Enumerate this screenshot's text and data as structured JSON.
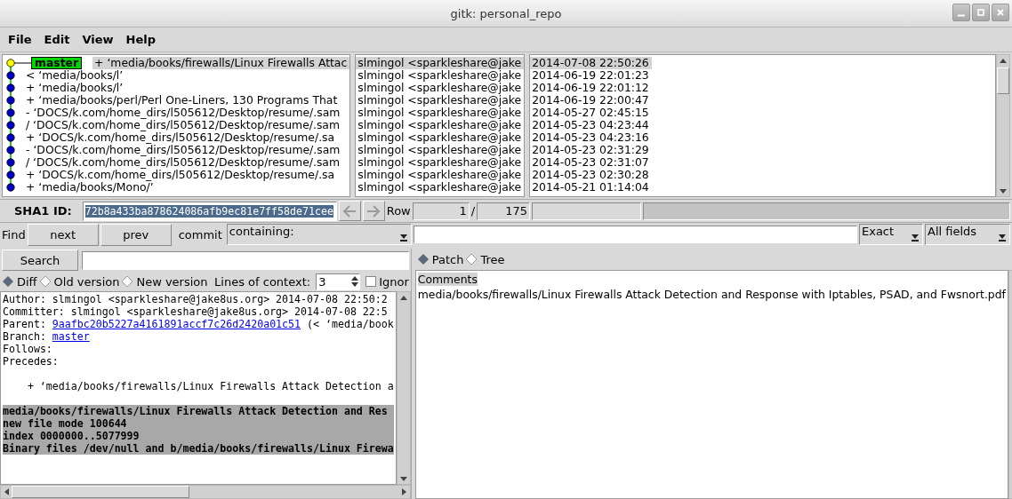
{
  "window": {
    "title": "gitk: personal_repo"
  },
  "menu": [
    "File",
    "Edit",
    "View",
    "Help"
  ],
  "commits": [
    {
      "subject": "+ ‘media/books/firewalls/Linux Firewalls Attac",
      "author": "slmingol <sparkleshare@jake",
      "date": "2014-07-08 22:50:26",
      "selected": true,
      "current": true,
      "branch": "master"
    },
    {
      "subject": "< ‘media/books/l’",
      "author": "slmingol <sparkleshare@jake",
      "date": "2014-06-19 22:01:23",
      "selected": false,
      "current": false
    },
    {
      "subject": "+ ‘media/books/l’",
      "author": "slmingol <sparkleshare@jake",
      "date": "2014-06-19 22:01:12",
      "selected": false,
      "current": false
    },
    {
      "subject": "+ ‘media/books/perl/Perl One-Liners, 130 Programs That",
      "author": "slmingol <sparkleshare@jake",
      "date": "2014-06-19 22:00:47",
      "selected": false,
      "current": false
    },
    {
      "subject": "- ‘DOCS/k.com/home_dirs/l505612/Desktop/resume/.sam",
      "author": "slmingol <sparkleshare@jake",
      "date": "2014-05-27 02:45:15",
      "selected": false,
      "current": false
    },
    {
      "subject": "/ ‘DOCS/k.com/home_dirs/l505612/Desktop/resume/.sam",
      "author": "slmingol <sparkleshare@jake",
      "date": "2014-05-23 04:23:44",
      "selected": false,
      "current": false
    },
    {
      "subject": "+ ‘DOCS/k.com/home_dirs/l505612/Desktop/resume/.sa",
      "author": "slmingol <sparkleshare@jake",
      "date": "2014-05-23 04:23:16",
      "selected": false,
      "current": false
    },
    {
      "subject": "- ‘DOCS/k.com/home_dirs/l505612/Desktop/resume/.sam",
      "author": "slmingol <sparkleshare@jake",
      "date": "2014-05-23 02:31:29",
      "selected": false,
      "current": false
    },
    {
      "subject": "/ ‘DOCS/k.com/home_dirs/l505612/Desktop/resume/.sam",
      "author": "slmingol <sparkleshare@jake",
      "date": "2014-05-23 02:31:07",
      "selected": false,
      "current": false
    },
    {
      "subject": "+ ‘DOCS/k.com/home_dirs/l505612/Desktop/resume/.sa",
      "author": "slmingol <sparkleshare@jake",
      "date": "2014-05-23 02:30:28",
      "selected": false,
      "current": false
    },
    {
      "subject": "+ ‘media/books/Mono/’",
      "author": "slmingol <sparkleshare@jake",
      "date": "2014-05-21 01:14:04",
      "selected": false,
      "current": false
    }
  ],
  "sha1": {
    "label": "SHA1 ID:",
    "value": "72b8a433ba878624086afb9ec81e7ff58de71cee"
  },
  "row": {
    "label": "Row",
    "current": "1",
    "separator": "/",
    "total": "175"
  },
  "find": {
    "label": "Find",
    "next": "next",
    "prev": "prev",
    "type_label": "commit",
    "mode": "containing:",
    "match": "Exact",
    "fields": "All fields"
  },
  "search": {
    "button": "Search"
  },
  "diff_modes": [
    {
      "label": "Diff",
      "selected": true
    },
    {
      "label": "Old version",
      "selected": false
    },
    {
      "label": "New version",
      "selected": false
    }
  ],
  "context": {
    "label": "Lines of context:",
    "value": "3"
  },
  "ignore": {
    "label": "Ignor",
    "checked": false
  },
  "diff_lines": [
    {
      "kind": "text",
      "text": "Author: slmingol <sparkleshare@jake8us.org>  2014-07-08 22:50:2"
    },
    {
      "kind": "text",
      "text": "Committer: slmingol <sparkleshare@jake8us.org>  2014-07-08 22:5"
    },
    {
      "kind": "link",
      "label": "Parent: ",
      "link": "9aafbc20b5227a4161891accf7c26d2420a01c51",
      "suffix": " (< ‘media/book"
    },
    {
      "kind": "link",
      "label": "Branch: ",
      "link": "master"
    },
    {
      "kind": "text",
      "text": "Follows:"
    },
    {
      "kind": "text",
      "text": "Precedes:"
    },
    {
      "kind": "subject",
      "text": "+ ‘media/books/firewalls/Linux Firewalls Attack Detection a"
    },
    {
      "kind": "file",
      "text": " media/books/firewalls/Linux Firewalls Attack Detection and Res"
    },
    {
      "kind": "file",
      "text": "new file mode 100644"
    },
    {
      "kind": "file",
      "text": "index 0000000..5077999"
    },
    {
      "kind": "file",
      "text": "Binary files /dev/null and b/media/books/firewalls/Linux Firewa"
    }
  ],
  "view_modes": [
    {
      "label": "Patch",
      "selected": true
    },
    {
      "label": "Tree",
      "selected": false
    }
  ],
  "files": [
    {
      "text": "Comments",
      "selected": true
    },
    {
      "text": "media/books/firewalls/Linux Firewalls Attack Detection and Response with Iptables, PSAD, and Fwsnort.pdf",
      "selected": false
    }
  ]
}
